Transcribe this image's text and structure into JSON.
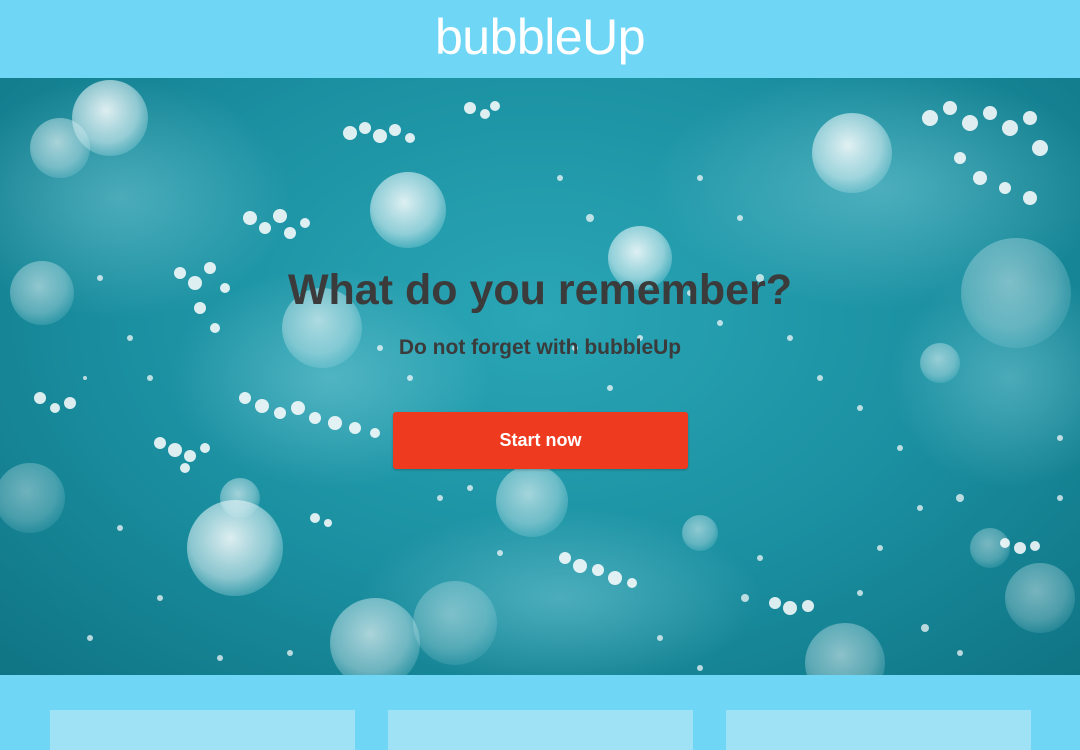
{
  "header": {
    "logo_text": "bubbleUp"
  },
  "hero": {
    "headline": "What do you remember?",
    "subheadline": "Do not forget with bubbleUp",
    "cta_label": "Start now",
    "background": "underwater-bubbles-image"
  },
  "colors": {
    "brand": "#6fd6f5",
    "cta": "#ee3a1f",
    "text_dark": "#3b3b3b",
    "card": "#9fe2f6"
  },
  "cards": [
    {
      "id": "card-1"
    },
    {
      "id": "card-2"
    },
    {
      "id": "card-3"
    }
  ]
}
